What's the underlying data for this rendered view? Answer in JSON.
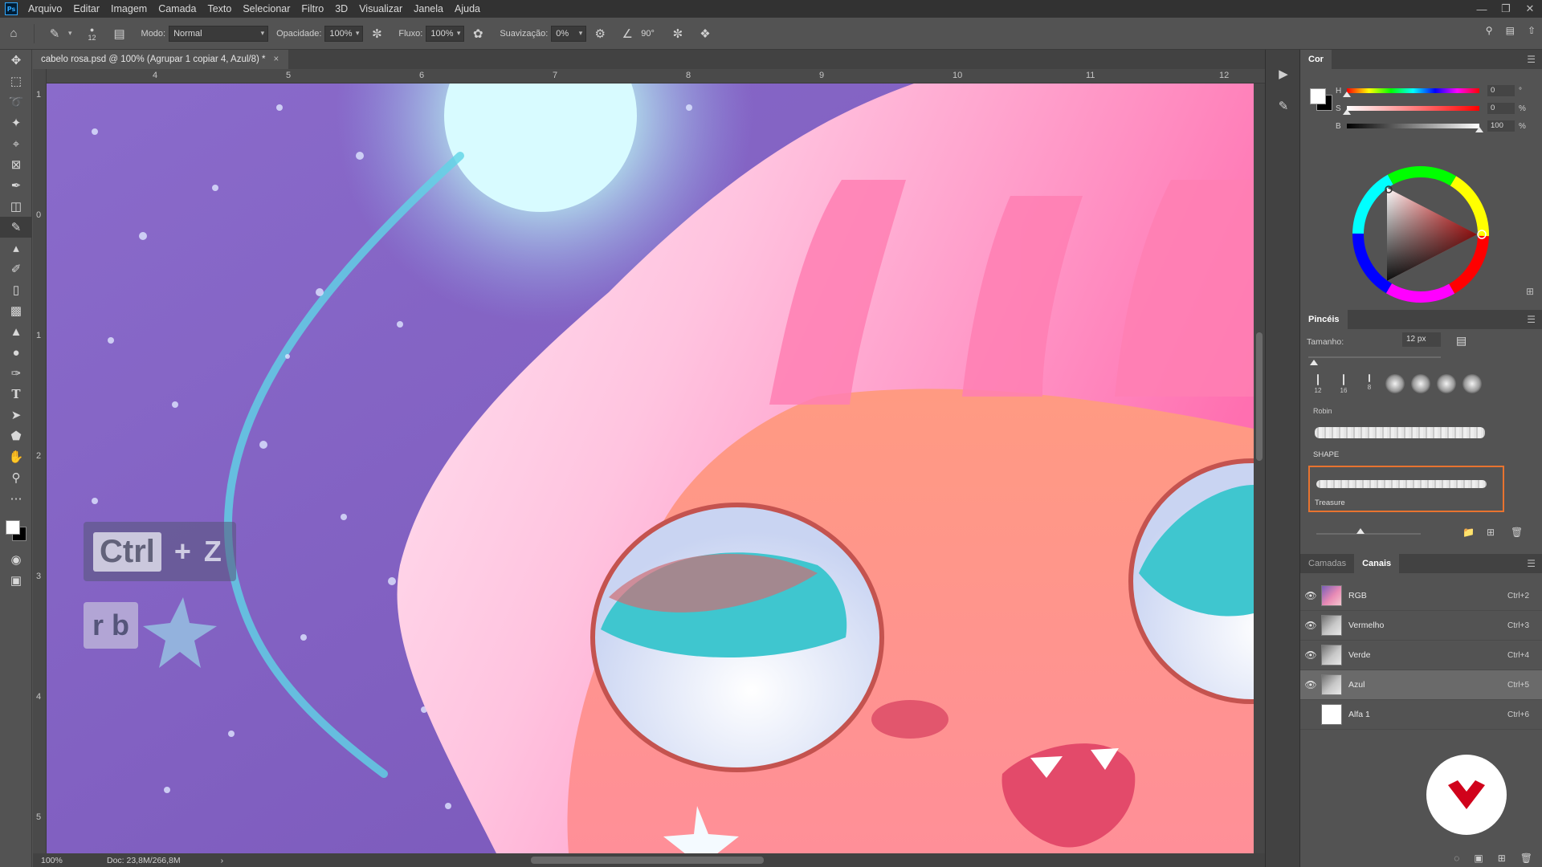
{
  "app": {
    "logo": "Ps"
  },
  "menu": [
    "Arquivo",
    "Editar",
    "Imagem",
    "Camada",
    "Texto",
    "Selecionar",
    "Filtro",
    "3D",
    "Visualizar",
    "Janela",
    "Ajuda"
  ],
  "options": {
    "brush_size": "12",
    "mode_label": "Modo:",
    "mode_value": "Normal",
    "opacity_label": "Opacidade:",
    "opacity_value": "100%",
    "flow_label": "Fluxo:",
    "flow_value": "100%",
    "smoothing_label": "Suavização:",
    "smoothing_value": "0%",
    "angle_value": "90°"
  },
  "document": {
    "tab_title": "cabelo rosa.psd @ 100% (Agrupar 1 copiar 4, Azul/8) *",
    "ruler_h": [
      "4",
      "5",
      "6",
      "7",
      "8",
      "9",
      "10",
      "11",
      "12"
    ],
    "ruler_v": [
      "1",
      "0",
      "1",
      "2",
      "3",
      "4",
      "5"
    ],
    "zoom": "100%",
    "doc_info": "Doc: 23,8M/266,8M"
  },
  "overlay": {
    "key1": "Ctrl",
    "plus": "+",
    "key2": "Z",
    "key3": "r b"
  },
  "color_panel": {
    "tab": "Cor",
    "h_label": "H",
    "h_value": "0",
    "h_unit": "°",
    "s_label": "S",
    "s_value": "0",
    "s_unit": "%",
    "b_label": "B",
    "b_value": "100",
    "b_unit": "%",
    "levels": {
      "h": 0,
      "s": 0,
      "b": 1.0
    },
    "foreground": "#ffffff",
    "background": "#000000"
  },
  "brush_panel": {
    "tab": "Pincéis",
    "size_label": "Tamanho:",
    "size_value": "12 px",
    "presets": [
      "12",
      "16",
      "8"
    ],
    "brushes": [
      {
        "name": "Robin"
      },
      {
        "name": "SHAPE"
      },
      {
        "name": "Treasure"
      }
    ]
  },
  "channels_panel": {
    "tabs": [
      "Camadas",
      "Canais"
    ],
    "active_tab": "Canais",
    "rows": [
      {
        "name": "RGB",
        "shortcut": "Ctrl+2",
        "visible": true
      },
      {
        "name": "Vermelho",
        "shortcut": "Ctrl+3",
        "visible": true
      },
      {
        "name": "Verde",
        "shortcut": "Ctrl+4",
        "visible": true
      },
      {
        "name": "Azul",
        "shortcut": "Ctrl+5",
        "visible": true
      },
      {
        "name": "Alfa 1",
        "shortcut": "Ctrl+6",
        "visible": false
      }
    ]
  },
  "colors": {
    "accent_orange": "#e8732f",
    "brand_red": "#d0021b"
  }
}
